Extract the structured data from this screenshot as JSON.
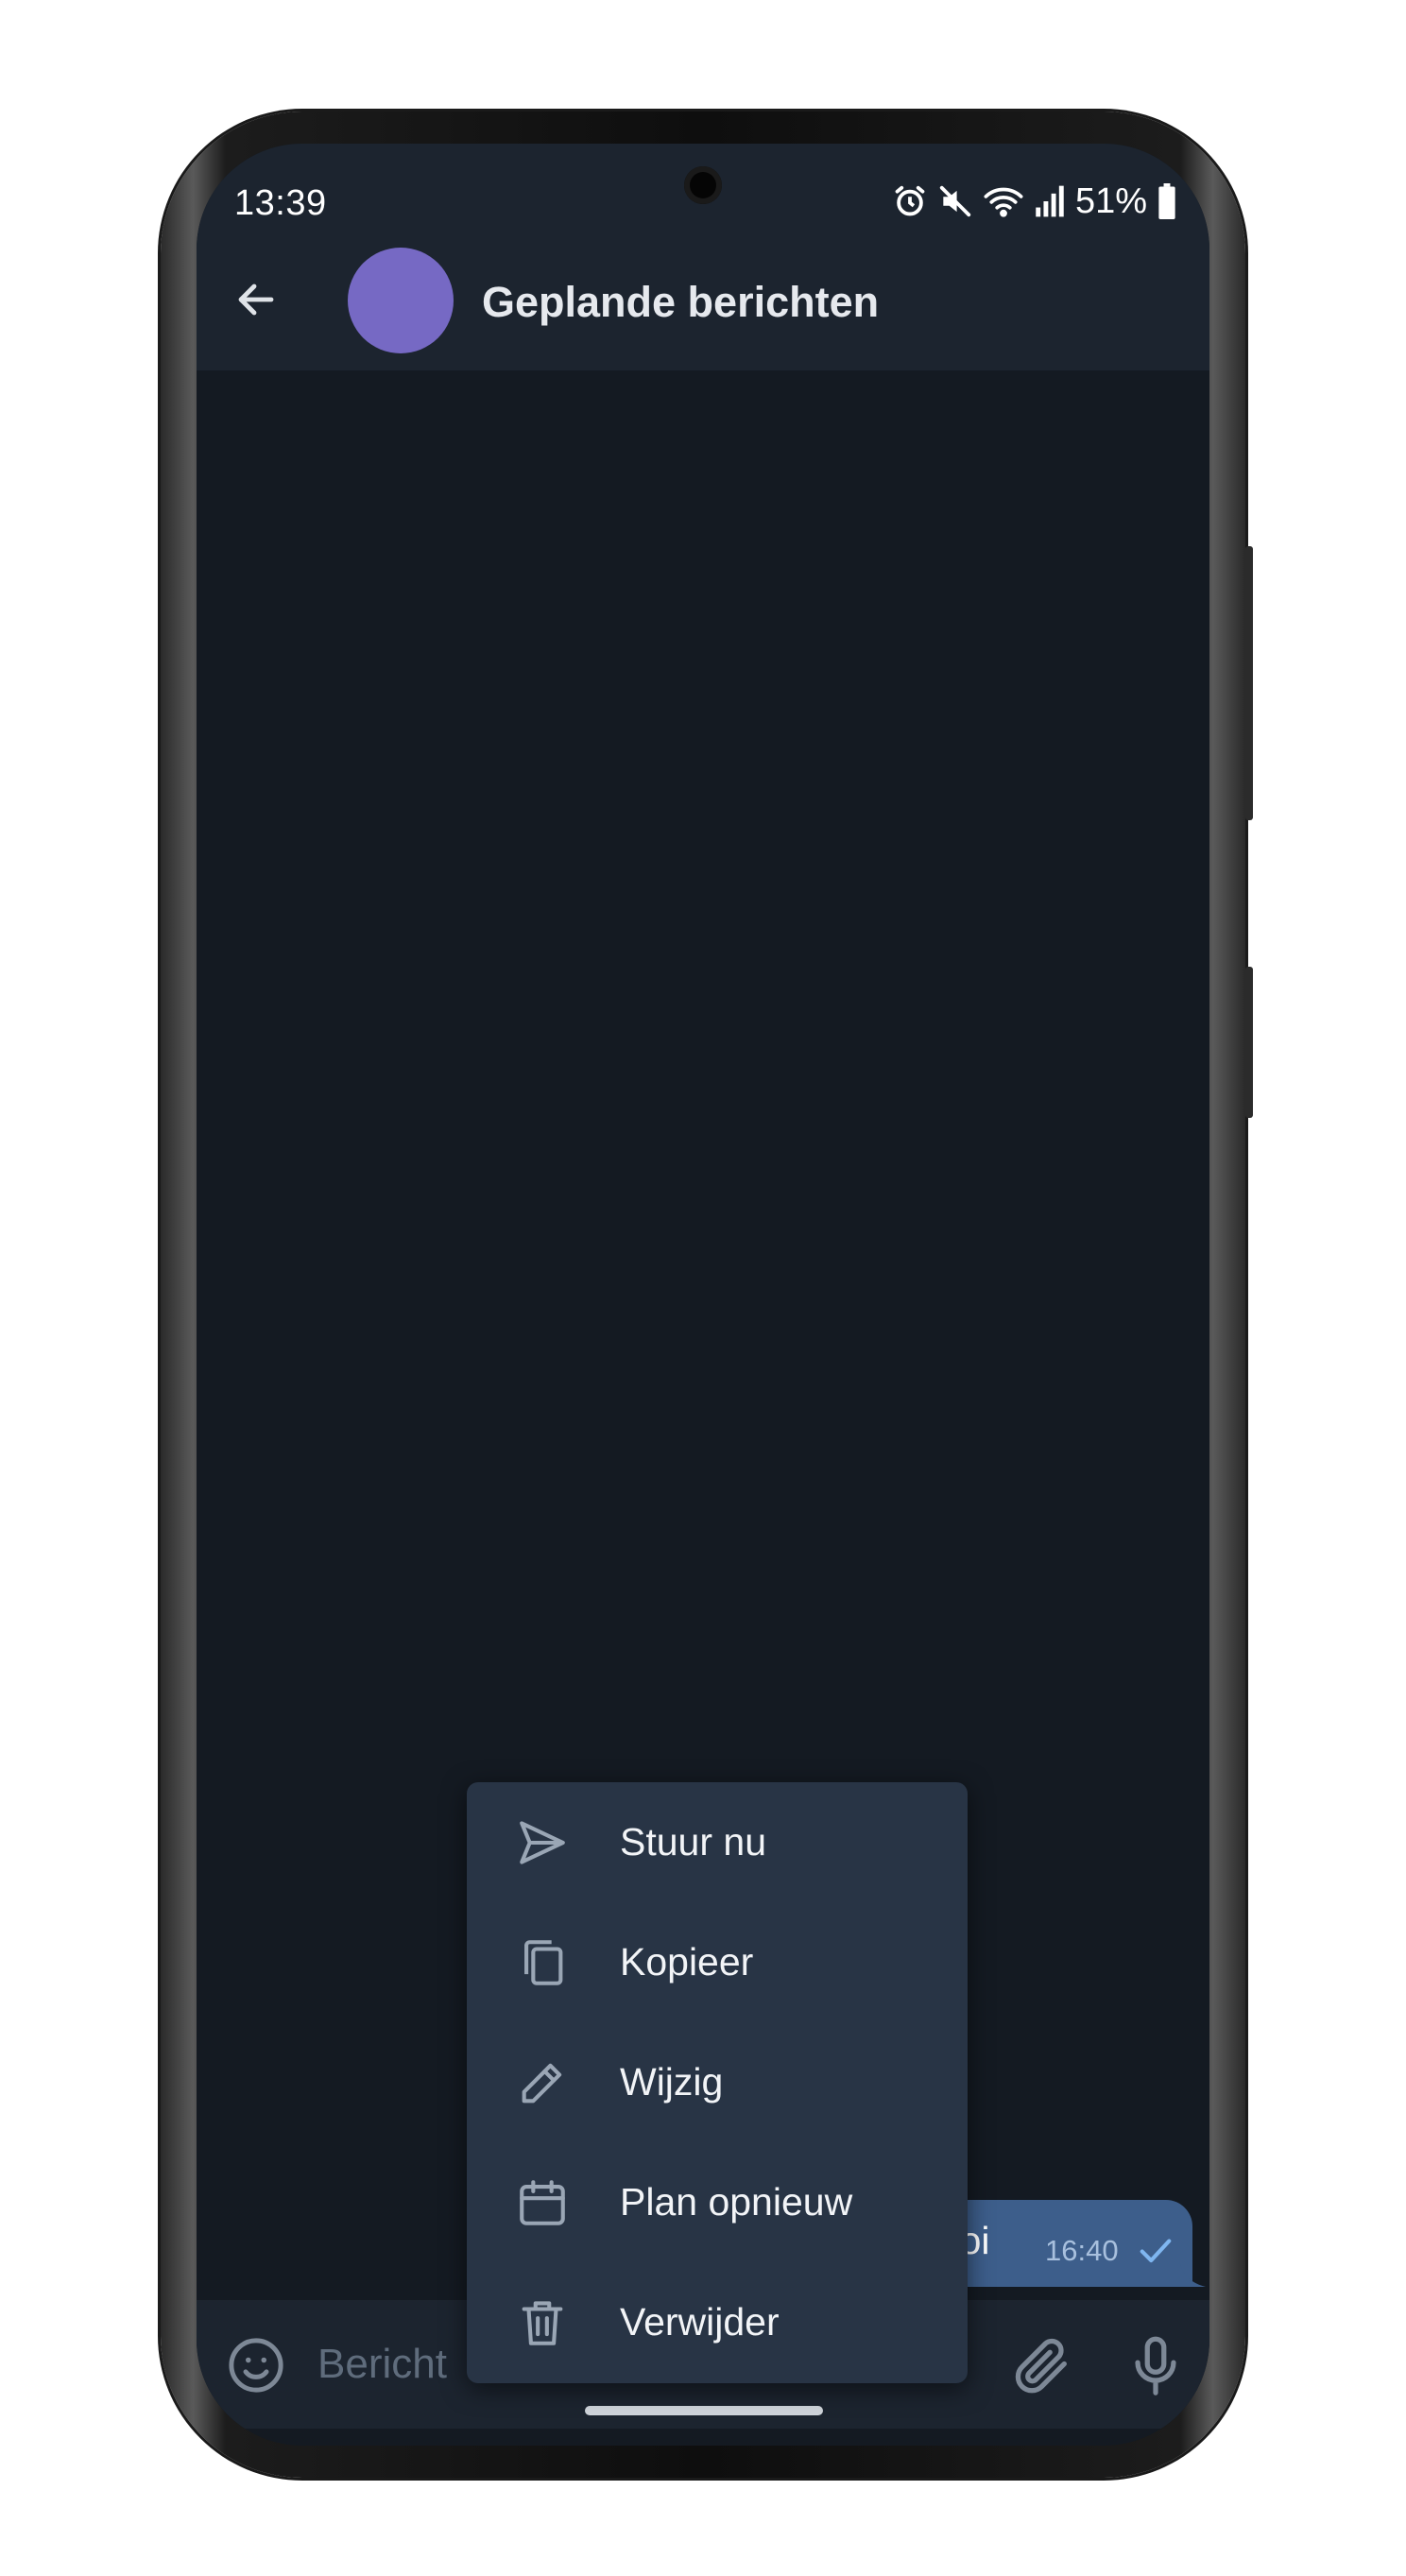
{
  "status_bar": {
    "time": "13:39",
    "battery_percent": "51%",
    "icons": [
      "alarm-icon",
      "mute-icon",
      "wifi-icon",
      "signal-icon",
      "battery-icon"
    ]
  },
  "app_bar": {
    "title": "Geplande berichten",
    "avatar_color": "#7669c4"
  },
  "message": {
    "text": "Hoi",
    "time": "16:40",
    "bubble_color": "#3d5e8b"
  },
  "context_menu": {
    "items": [
      {
        "label": "Stuur nu",
        "icon": "send-icon"
      },
      {
        "label": "Kopieer",
        "icon": "copy-icon"
      },
      {
        "label": "Wijzig",
        "icon": "pencil-icon"
      },
      {
        "label": "Plan opnieuw",
        "icon": "calendar-icon"
      },
      {
        "label": "Verwijder",
        "icon": "trash-icon"
      }
    ]
  },
  "input_bar": {
    "placeholder": "Bericht"
  },
  "colors": {
    "background": "#141a22",
    "bar": "#1c242f",
    "menu": "#283445",
    "icon": "#9aa6b5"
  }
}
